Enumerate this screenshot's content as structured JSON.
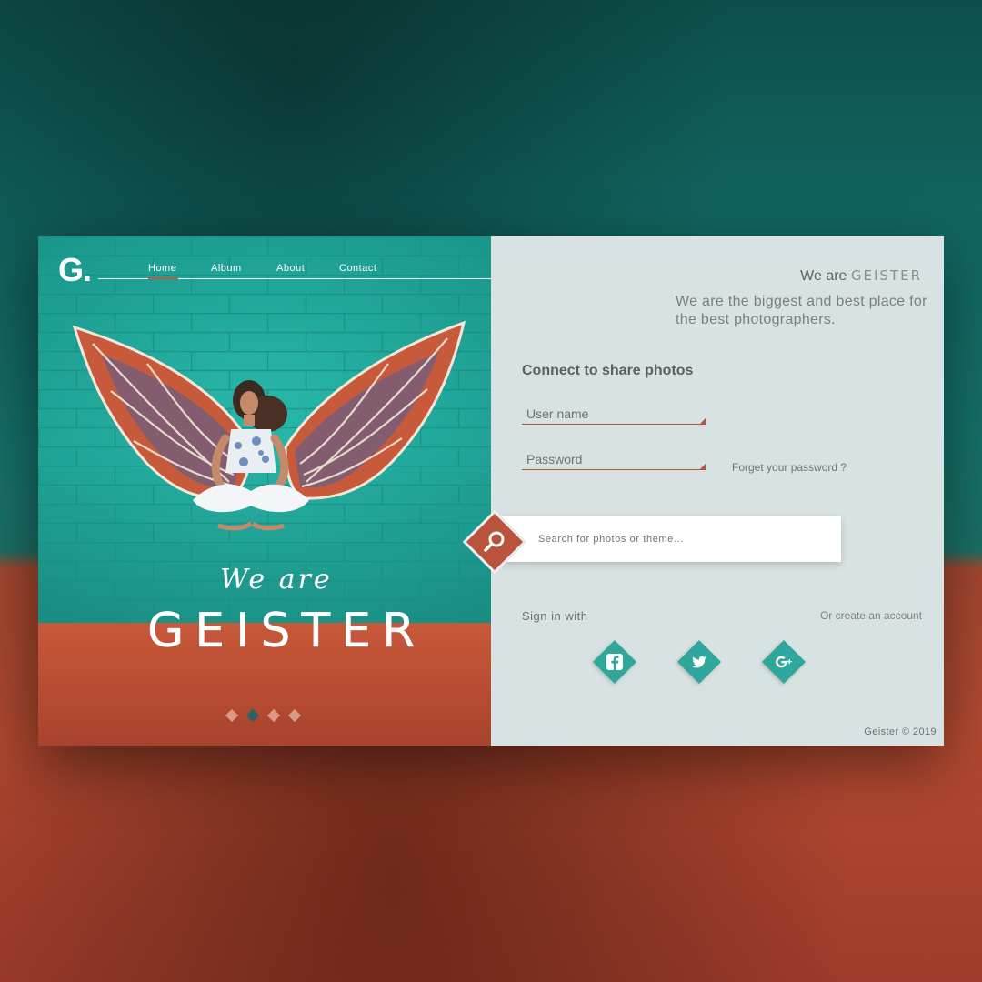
{
  "brand": {
    "logo": "G.",
    "name": "GEISTER"
  },
  "nav": {
    "items": [
      {
        "label": "Home",
        "active": true
      },
      {
        "label": "Album",
        "active": false
      },
      {
        "label": "About",
        "active": false
      },
      {
        "label": "Contact",
        "active": false
      }
    ]
  },
  "hero": {
    "we_are": "We are",
    "brand_display": "GEISTER",
    "slides": {
      "count": 4,
      "active_index": 1
    }
  },
  "intro": {
    "we_are": "We are",
    "brand": "GEISTER",
    "subtitle": "We are the biggest and best place for the best photographers."
  },
  "login": {
    "title": "Connect to share photos",
    "username_placeholder": "User name",
    "password_placeholder": "Password",
    "forgot_label": "Forget your password ?"
  },
  "search": {
    "placeholder": "Search for photos or theme..."
  },
  "social": {
    "sign_in_label": "Sign in with",
    "create_account_label": "Or create an account",
    "providers": [
      "facebook-icon",
      "twitter-icon",
      "google-plus-icon"
    ]
  },
  "footer": {
    "copyright": "Geister © 2019"
  },
  "colors": {
    "accent_teal": "#2fa89b",
    "accent_red": "#b9533c",
    "panel_bg": "#d9e2e2"
  }
}
